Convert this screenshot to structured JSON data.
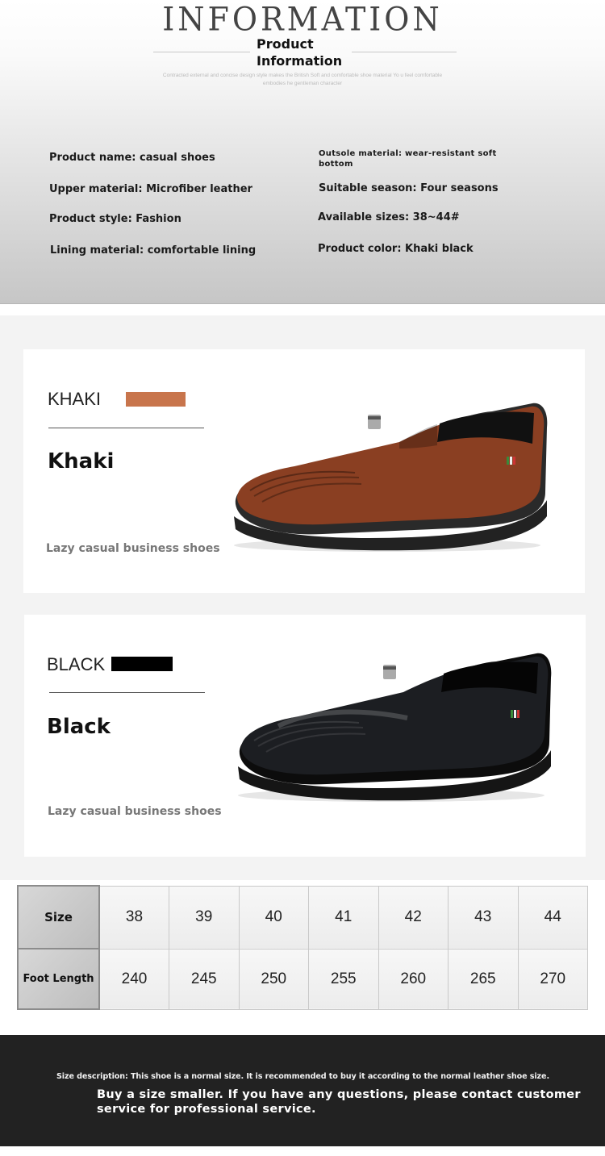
{
  "header": {
    "title": "INFORMATION",
    "subtitle": "Product Information",
    "tagline": "Contracted external and concise design style makes the British Soft and comfortable shoe material Yo u feel comfortable embodies he gentleman character"
  },
  "specs": {
    "product_name": "Product name: casual shoes",
    "upper_material": "Upper material: Microfiber leather",
    "product_style": "Product style: Fashion",
    "lining_material": "Lining material: comfortable lining",
    "outsole_material": "Outsole material: wear-resistant soft bottom",
    "suitable_season": "Suitable season: Four seasons",
    "available_sizes": "Available sizes: 38~44#",
    "product_color": "Product color: Khaki black"
  },
  "colors": [
    {
      "code": "KHAKI",
      "name": "Khaki",
      "description": "Lazy casual business shoes",
      "swatch_color": "#c8754c",
      "shoe_color": "#8a3f22"
    },
    {
      "code": "BLACK",
      "name": "Black",
      "description": "Lazy casual business shoes",
      "swatch_color": "#000000",
      "shoe_color": "#1c1e22"
    }
  ],
  "size_table": {
    "size_header": "Size",
    "foot_header": "Foot Length",
    "sizes": [
      "38",
      "39",
      "40",
      "41",
      "42",
      "43",
      "44"
    ],
    "foot_lengths": [
      "240",
      "245",
      "250",
      "255",
      "260",
      "265",
      "270"
    ]
  },
  "footer": {
    "size_description": "Size description: This shoe is a normal size. It is recommended to buy it according to the normal leather shoe size.",
    "advice": "Buy a size smaller. If you have any questions, please contact customer service for professional service."
  }
}
